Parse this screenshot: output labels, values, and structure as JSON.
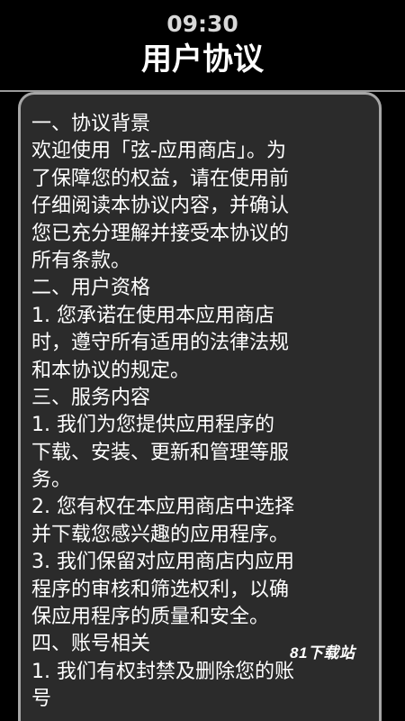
{
  "status_bar": {
    "time": "09:30"
  },
  "page": {
    "title": "用户协议"
  },
  "agreement": {
    "lines": [
      "一、协议背景",
      "欢迎使用「弦-应用商店」。为",
      "了保障您的权益，请在使用前",
      "仔细阅读本协议内容，并确认",
      "您已充分理解并接受本协议的",
      "所有条款。",
      "二、用户资格",
      " 1. 您承诺在使用本应用商店",
      "时，遵守所有适用的法律法规",
      "和本协议的规定。",
      "三、服务内容",
      " 1. 我们为您提供应用程序的",
      "下载、安装、更新和管理等服",
      "务。",
      " 2. 您有权在本应用商店中选择",
      "并下载您感兴趣的应用程序。",
      " 3. 我们保留对应用商店内应用",
      "程序的审核和筛选权利，以确",
      "保应用程序的质量和安全。",
      "四、账号相关",
      " 1. 我们有权封禁及删除您的账",
      "号"
    ]
  },
  "watermark": {
    "text": "81下载站"
  }
}
